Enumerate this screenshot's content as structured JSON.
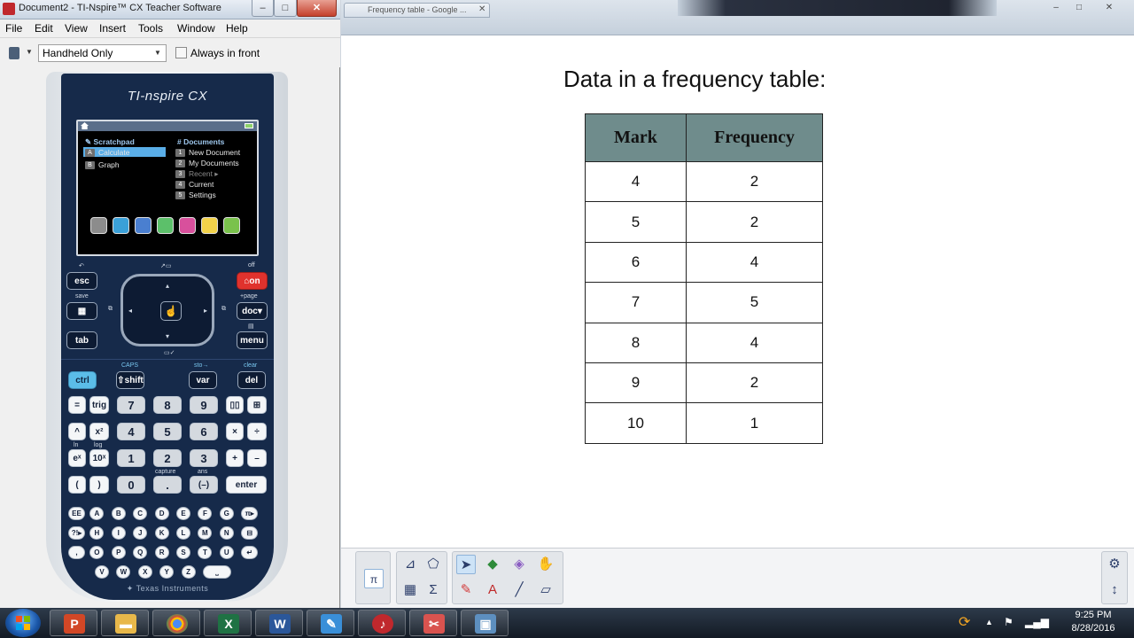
{
  "ti_window": {
    "title": "Document2 - TI-Nspire™ CX Teacher Software",
    "min_glyph": "–",
    "max_glyph": "□",
    "close_glyph": "✕",
    "menu": [
      "File",
      "Edit",
      "View",
      "Insert",
      "Tools",
      "Window",
      "Help"
    ],
    "view_select": "Handheld Only",
    "always_in_front": "Always in front"
  },
  "calculator": {
    "brand": "TI-nspire CX",
    "screen": {
      "left_heading": "Scratchpad",
      "left_items": [
        {
          "key": "A",
          "label": "Calculate"
        },
        {
          "key": "B",
          "label": "Graph"
        }
      ],
      "right_heading": "Documents",
      "right_items": [
        {
          "key": "1",
          "label": "New Document"
        },
        {
          "key": "2",
          "label": "My Documents"
        },
        {
          "key": "3",
          "label": "Recent ▸"
        },
        {
          "key": "4",
          "label": "Current"
        },
        {
          "key": "5",
          "label": "Settings"
        }
      ],
      "app_colors": [
        "#8c8c8c",
        "#3aa0d8",
        "#4a7fd0",
        "#5cc06a",
        "#d8509c",
        "#f2d24a",
        "#7ac24c"
      ]
    },
    "keys": {
      "esc": "esc",
      "save_label": "save",
      "tab": "tab",
      "on": "on",
      "off_label": "off",
      "doc": "doc",
      "page_label": "+page",
      "menu": "menu",
      "ctrl": "ctrl",
      "shift": "shift",
      "caps_label": "CAPS",
      "var": "var",
      "sto_label": "sto→",
      "del": "del",
      "clear_label": "clear",
      "equals": "=",
      "trig": "trig",
      "caret": "^",
      "square": "x²",
      "exp": "eˣ",
      "ten_pow": "10ˣ",
      "lparen": "(",
      "rparen": ")",
      "n7": "7",
      "n8": "8",
      "n9": "9",
      "n4": "4",
      "n5": "5",
      "n6": "6",
      "n1": "1",
      "n2": "2",
      "n3": "3",
      "n0": "0",
      "dot": ".",
      "neg": "(–)",
      "times": "×",
      "divide": "÷",
      "plus": "+",
      "minus": "–",
      "enter": "enter",
      "capture_label": "capture",
      "ans_label": "ans",
      "ln_label": "ln",
      "log_label": "log"
    },
    "alpha_rows": [
      [
        "EE",
        "A",
        "B",
        "C",
        "D",
        "E",
        "F",
        "G",
        "π▸"
      ],
      [
        "?!▸",
        "H",
        "I",
        "J",
        "K",
        "L",
        "M",
        "N",
        "⊟"
      ],
      [
        ",",
        "O",
        "P",
        "Q",
        "R",
        "S",
        "T",
        "U",
        "↵"
      ],
      [
        "V",
        "W",
        "X",
        "Y",
        "Z",
        "⎵"
      ]
    ],
    "footer": "Texas Instruments"
  },
  "doc_window": {
    "tab_label": "Frequency table - Google ...",
    "tab_close": "✕",
    "heading": "Data in a frequency table:",
    "table": {
      "headers": [
        "Mark",
        "Frequency"
      ],
      "rows": [
        [
          "4",
          "2"
        ],
        [
          "5",
          "2"
        ],
        [
          "6",
          "4"
        ],
        [
          "7",
          "5"
        ],
        [
          "8",
          "4"
        ],
        [
          "9",
          "2"
        ],
        [
          "10",
          "1"
        ]
      ]
    }
  },
  "taskbar": {
    "time": "9:25 PM",
    "date": "8/28/2016"
  }
}
